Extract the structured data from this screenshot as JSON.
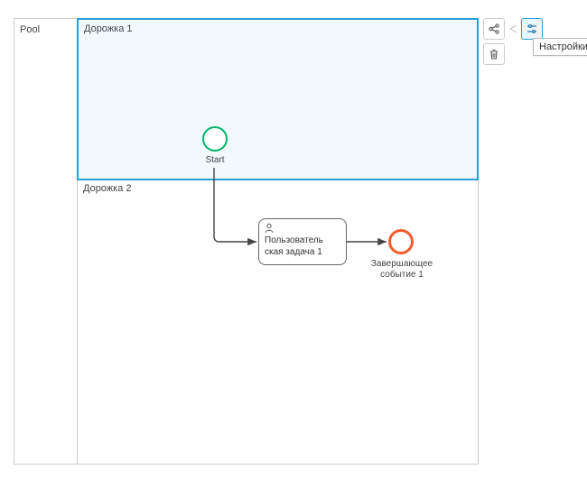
{
  "pool": {
    "label": "Pool"
  },
  "lanes": [
    {
      "label": "Дорожка 1"
    },
    {
      "label": "Дорожка 2"
    }
  ],
  "nodes": {
    "start": {
      "label": "Start"
    },
    "user_task": {
      "label": "Пользователь\nская задача 1"
    },
    "end": {
      "label": "Завершающее событие 1"
    }
  },
  "toolbar": {
    "share_icon": "share",
    "settings_icon": "settings",
    "delete_icon": "delete",
    "tooltip": "Настройки"
  }
}
